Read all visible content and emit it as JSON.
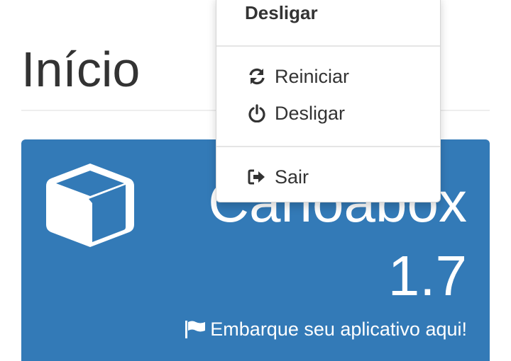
{
  "page": {
    "title": "Início"
  },
  "card": {
    "title": "Canoabox",
    "version": "1.7",
    "link_label": "Embarque seu aplicativo aqui!",
    "background": "#337ab7",
    "icon": "cube-icon",
    "link_icon": "flag-icon"
  },
  "dropdown": {
    "header": "Desligar",
    "items": [
      {
        "label": "Reiniciar",
        "icon": "refresh-icon"
      },
      {
        "label": "Desligar",
        "icon": "power-icon"
      },
      {
        "label": "Sair",
        "icon": "sign-out-icon"
      }
    ]
  }
}
